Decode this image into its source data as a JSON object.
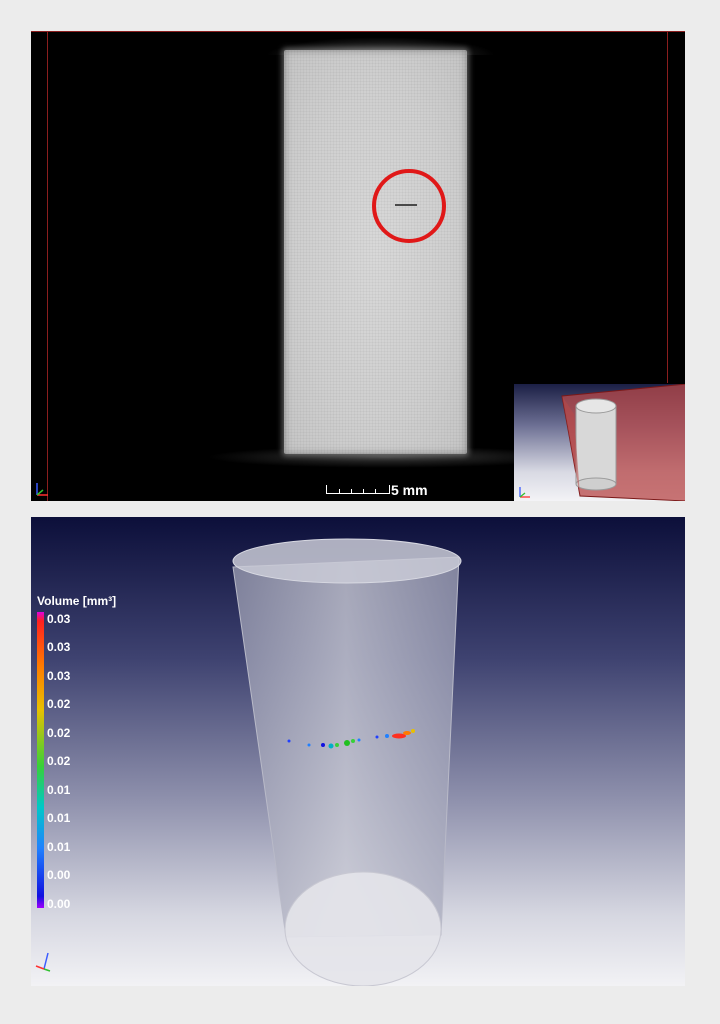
{
  "slice_view": {
    "scale_bar_label": "5 mm"
  },
  "volume_view": {
    "legend": {
      "title": "Volume [mm³]",
      "ticks": [
        "0.03",
        "0.03",
        "0.03",
        "0.02",
        "0.02",
        "0.02",
        "0.01",
        "0.01",
        "0.01",
        "0.00",
        "0.00"
      ]
    }
  },
  "axes_icons": [
    "axes-triad-icon"
  ],
  "colors": {
    "highlight_circle": "#e01818",
    "frame_line": "#8b1e1e",
    "viewport_bg_top": "#000000"
  }
}
